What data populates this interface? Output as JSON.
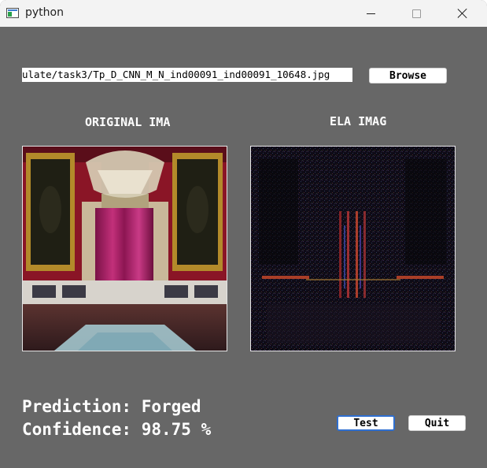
{
  "window": {
    "title": "python",
    "controls": {
      "minimize_icon": "minimize-icon",
      "maximize_icon": "maximize-icon",
      "close_icon": "close-icon"
    }
  },
  "file_select": {
    "path_value": "ulate/task3/Tp_D_CNN_M_N_ind00091_ind00091_10648.jpg",
    "browse_label": "Browse"
  },
  "panels": {
    "original_title": "ORIGINAL IMA",
    "ela_title": "ELA IMAG"
  },
  "results": {
    "prediction_text": "Prediction: Forged",
    "confidence_text": "Confidence: 98.75 %"
  },
  "actions": {
    "test_label": "Test",
    "quit_label": "Quit"
  },
  "colors": {
    "window_bg": "#676767",
    "titlebar_bg": "#f3f3f3",
    "text_on_dark": "#ffffff",
    "focus_border": "#2f6fd0"
  }
}
